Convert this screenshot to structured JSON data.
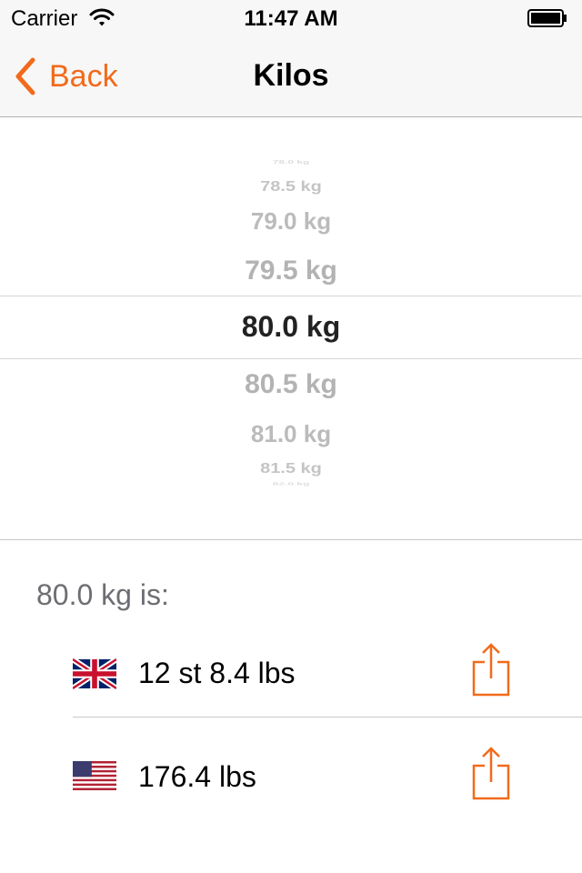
{
  "status_bar": {
    "carrier": "Carrier",
    "time": "11:47 AM"
  },
  "nav": {
    "back_label": "Back",
    "title": "Kilos"
  },
  "picker": {
    "items": [
      "78.0 kg",
      "78.5 kg",
      "79.0 kg",
      "79.5 kg",
      "80.0 kg",
      "80.5 kg",
      "81.0 kg",
      "81.5 kg",
      "82.0 kg"
    ],
    "selected": "80.0 kg"
  },
  "results": {
    "caption": "80.0 kg is:",
    "rows": [
      {
        "flag": "uk-flag-icon",
        "value": "12 st 8.4 lbs"
      },
      {
        "flag": "us-flag-icon",
        "value": "176.4 lbs"
      }
    ]
  },
  "colors": {
    "accent": "#f26a1b",
    "bar_background": "#f7f7f7",
    "picker_dim": "#b3b3b3"
  }
}
